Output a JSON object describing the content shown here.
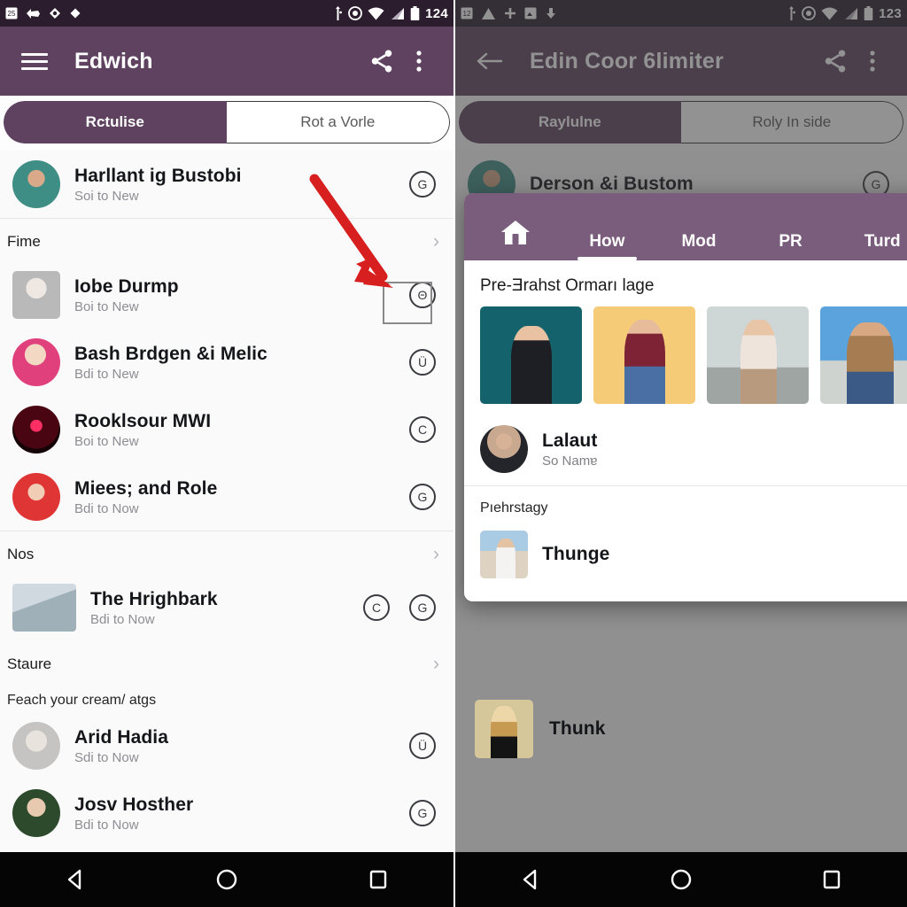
{
  "left": {
    "status_bar": {
      "battery_text": "124",
      "left_icons": [
        "calendar-icon",
        "arrow-pin-icon",
        "circle-dot-icon",
        "diamond-icon"
      ],
      "right_icons": [
        "usb-icon",
        "target-icon",
        "wifi-icon",
        "signal-icon",
        "battery-icon"
      ]
    },
    "appbar": {
      "title": "Edwich",
      "menu_icon": "hamburger-icon",
      "share_icon": "share-icon",
      "overflow_icon": "overflow-menu-icon"
    },
    "tabs": [
      {
        "label": "Rctulise",
        "active": true
      },
      {
        "label": "Rot a Vorle",
        "active": false
      }
    ],
    "items": [
      {
        "kind": "row",
        "title": "Harllant ig Bustobi",
        "subtitle": "Soi to New",
        "avatar": "p-teal",
        "avatar_shape": "circle",
        "actions": [
          "G"
        ]
      },
      {
        "kind": "section",
        "label": "Fime"
      },
      {
        "kind": "row",
        "title": "Iobe Durmp",
        "subtitle": "Boi to New",
        "avatar": "p-gray",
        "avatar_shape": "square",
        "actions": [
          "Θ"
        ],
        "highlighted": true
      },
      {
        "kind": "row",
        "title": "Bash Brdgen &i Melic",
        "subtitle": "Bdi to New",
        "avatar": "p-pink",
        "avatar_shape": "circle",
        "actions": [
          "Ü"
        ]
      },
      {
        "kind": "row",
        "title": "Rooklsour MWI",
        "subtitle": "Boi to New",
        "avatar": "p-darkred",
        "avatar_shape": "circle",
        "actions": [
          "C"
        ]
      },
      {
        "kind": "row",
        "title": "Miees; and Role",
        "subtitle": "Bdi to Now",
        "avatar": "p-red",
        "avatar_shape": "circle",
        "actions": [
          "G"
        ]
      },
      {
        "kind": "section",
        "label": "Nos"
      },
      {
        "kind": "row",
        "title": "The Hrighbark",
        "subtitle": "Bdi to Now",
        "avatar": "p-couple",
        "avatar_shape": "photo",
        "actions": [
          "C",
          "G"
        ]
      },
      {
        "kind": "section",
        "label": "Staure"
      },
      {
        "kind": "subhead",
        "label": "Feach your cream/ atgs"
      },
      {
        "kind": "row",
        "title": "Arid Hadia",
        "subtitle": "Sdi to Now",
        "avatar": "p-lightgray",
        "avatar_shape": "circle",
        "actions": [
          "Ü"
        ]
      },
      {
        "kind": "row",
        "title": "Josv Hosther",
        "subtitle": "Bdi to Now",
        "avatar": "p-green",
        "avatar_shape": "circle",
        "actions": [
          "G"
        ]
      }
    ]
  },
  "right": {
    "status_bar": {
      "battery_text": "123",
      "left_icons": [
        "calendar-icon",
        "alert-triangle-icon",
        "plus-icon",
        "photo-icon",
        "download-icon"
      ],
      "right_icons": [
        "usb-icon",
        "target-icon",
        "wifi-icon",
        "signal-icon",
        "battery-icon"
      ]
    },
    "appbar": {
      "title": "Edin Coor 6limiter",
      "back_icon": "back-arrow-icon",
      "share_icon": "share-icon",
      "overflow_icon": "overflow-menu-icon"
    },
    "tabs": [
      {
        "label": "Raylulne",
        "active": true
      },
      {
        "label": "Roly In side",
        "active": false
      }
    ],
    "background_row": {
      "title": "Derson &i Bustom",
      "avatar": "p-teal",
      "action": "G"
    },
    "modal": {
      "tabs": [
        {
          "label": "",
          "icon": "home-icon",
          "active": false
        },
        {
          "label": "How",
          "icon": "",
          "active": true
        },
        {
          "label": "Mod",
          "icon": "",
          "active": false
        },
        {
          "label": "PR",
          "icon": "",
          "active": false
        },
        {
          "label": "Turd",
          "icon": "",
          "active": false
        }
      ],
      "section_title": "Pre-Ǝrahst Ormarı lage",
      "thumbnails": [
        "p-suit",
        "p-yellow",
        "p-window",
        "p-sky"
      ],
      "rows": [
        {
          "title": "Lalaut",
          "subtitle": "So Namɐ",
          "avatar": "p-beachman",
          "shape": "circle"
        }
      ],
      "subhead": "Pıehrstagy",
      "rows2": [
        {
          "title": "Thunge",
          "avatar": "p-beachfam",
          "shape": "square"
        }
      ]
    },
    "outside_row": {
      "title": "Thunk",
      "avatar": "p-tan"
    }
  },
  "navbar": {
    "back_icon": "nav-back-icon",
    "home_icon": "nav-home-icon",
    "recents_icon": "nav-recents-icon"
  },
  "annotation": {
    "arrow_color": "#d81f1f",
    "highlight_border": "#8a8a8a"
  }
}
